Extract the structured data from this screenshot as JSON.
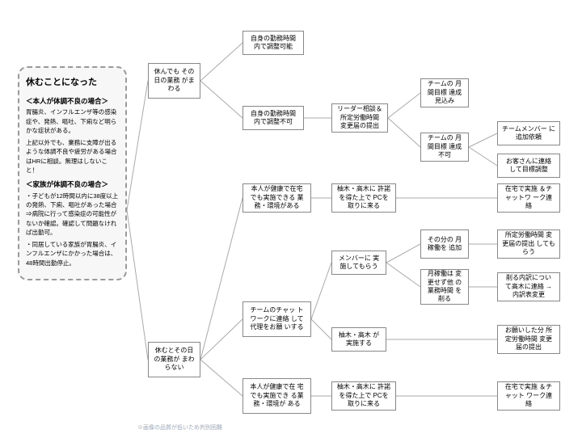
{
  "panel": {
    "title": "休むことになった",
    "h1": "＜本人が体調不良の場合＞",
    "p1": "胃腸炎、インフルエンザ等の感染症や、発熱、嘔吐、下痢など明らかな症状がある。",
    "p2": "上記以外でも、業務に支障が出るような体調不良や疲労がある場合はHRに相談。無理はしないこと！",
    "h2": "＜家族が体調不良の場合＞",
    "p3": "・子どもが12時間以内に38度以上の発熱、下痢、嘔吐があった場合\n⇒病院に行って感染症の可能性がないか確認。確認して問題なければ出勤可。",
    "p4": "・同居している家族が胃腸炎、インフルエンザにかかった場合は、48時間出勤停止。"
  },
  "nodes": {
    "n1": "休んでも\nその日の業務\nがまわる",
    "n2": "自身の勤務時間\n内で調整可能",
    "n3": "自身の勤務時間\n内で調整不可",
    "n4": "リーダー相談＆\n所定労働時間\n変更届の提出",
    "n5": "チームの\n月間目標\n達成見込み",
    "n6": "チームの\n月間目標\n達成不可",
    "n7": "チームメンバー\nに追加依頼",
    "n8": "お客さんに連絡\nして目標調整",
    "n9": "本人が健康で在宅\nでも実施できる\n業務・環境がある",
    "n10": "柚木・高木に\n許諾を得た上で\nPCを取りに来る",
    "n11": "在宅で実施\n＆チャットワ\nーク連絡",
    "n12": "休むとその日\nの業務が\nまわらない",
    "n13": "チームのチャッ\nトワークに連絡\nして代理をお願\nいする",
    "n14": "メンバーに\n実施してもらう",
    "n15": "その分の\n月稼働を\n追加",
    "n16": "月稼働は\n変更せず他\nの業務時間\nを削る",
    "n17": "柚木・高木\nが実施する",
    "n18": "所定労働時間\n変更届の提出\nしてもらう",
    "n19": "削る内訳につい\nて高木に連絡\n→内訳表変更",
    "n20": "お願いした分\n所定労働時間\n変更届の提出",
    "n21": "本人が健康で在\n宅でも実施でき\nる業務・環境が\nある",
    "n22": "柚木・高木に\n許諾を得た上で\nPCを取りに来る",
    "n23": "在宅で実施\n＆チャット\nワーク連絡"
  },
  "footer": "※画像の品質が低いため判別困難"
}
